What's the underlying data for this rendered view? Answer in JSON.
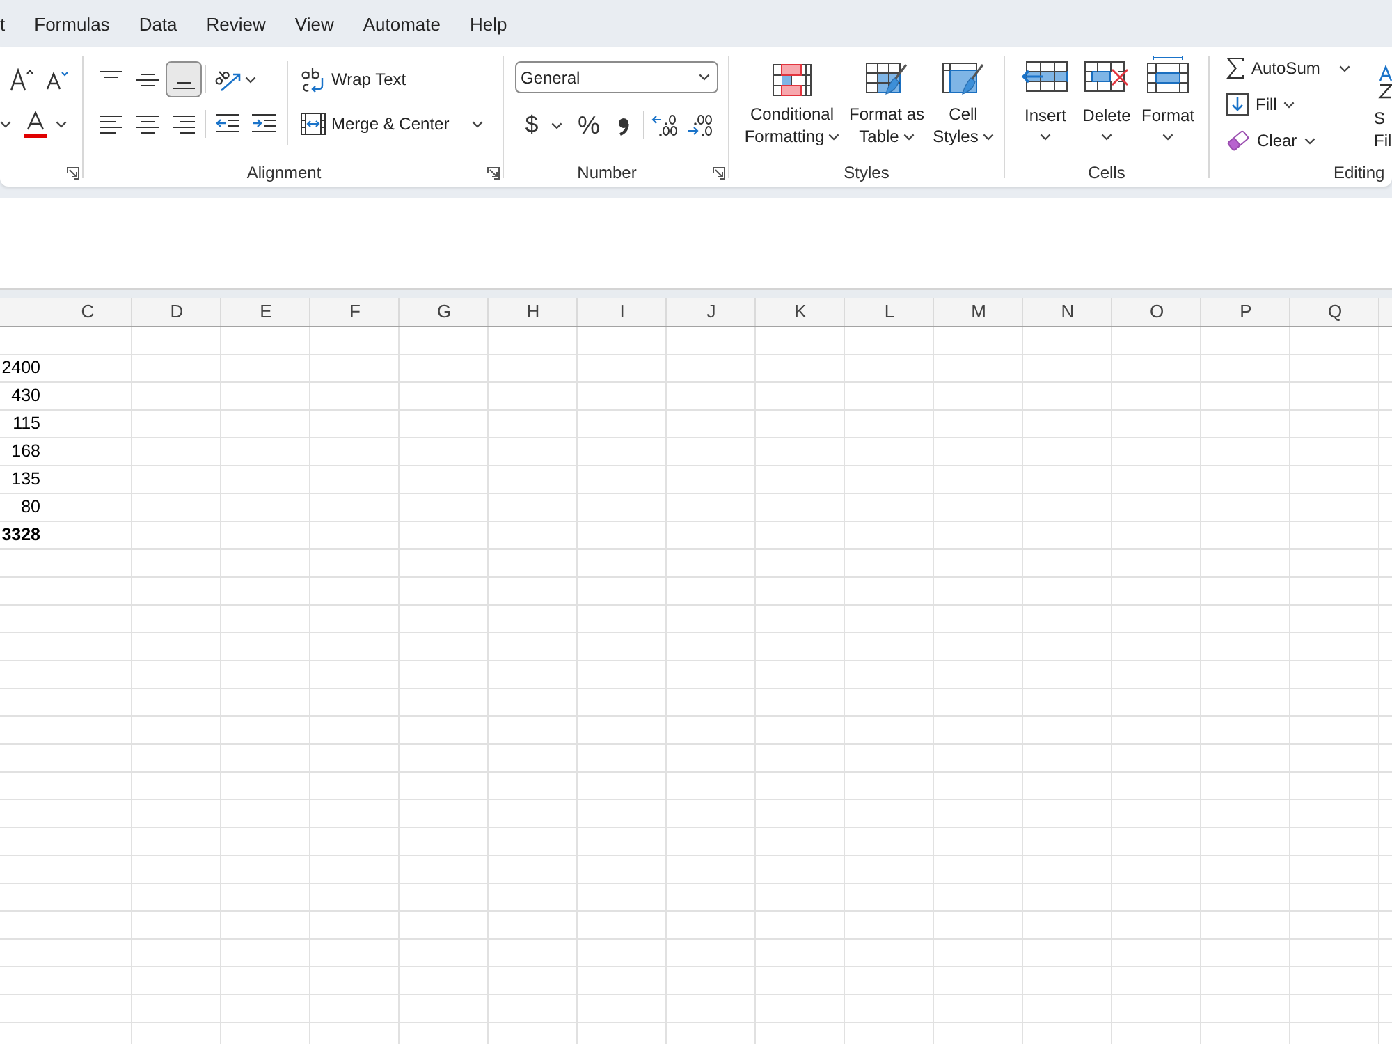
{
  "menu_tabs": [
    {
      "label": "t",
      "selected": false
    },
    {
      "label": "Formulas",
      "selected": false
    },
    {
      "label": "Data",
      "selected": false
    },
    {
      "label": "Review",
      "selected": false
    },
    {
      "label": "View",
      "selected": false
    },
    {
      "label": "Automate",
      "selected": false
    },
    {
      "label": "Help",
      "selected": false
    }
  ],
  "ribbon": {
    "alignment": {
      "label": "Alignment",
      "vertical": [
        {
          "kind": "top",
          "selected": false
        },
        {
          "kind": "middle",
          "selected": false
        },
        {
          "kind": "bottom",
          "selected": true
        }
      ],
      "horizontal": [
        {
          "kind": "left",
          "selected": false
        },
        {
          "kind": "center",
          "selected": false
        },
        {
          "kind": "right",
          "selected": false
        }
      ],
      "wrap_text": "Wrap Text",
      "merge": "Merge & Center"
    },
    "number": {
      "label": "Number",
      "format": "General",
      "currency": "$",
      "percent": "%"
    },
    "styles": {
      "label": "Styles",
      "buttons": [
        {
          "kind": "conditional",
          "lines": [
            "Conditional",
            "Formatting"
          ]
        },
        {
          "kind": "table",
          "lines": [
            "Format as",
            "Table"
          ]
        },
        {
          "kind": "cell",
          "lines": [
            "Cell",
            "Styles"
          ]
        }
      ]
    },
    "cells": {
      "label": "Cells",
      "buttons": [
        {
          "kind": "insert",
          "label": "Insert"
        },
        {
          "kind": "delete",
          "label": "Delete"
        },
        {
          "kind": "format",
          "label": "Format"
        }
      ]
    },
    "editing": {
      "label": "Editing",
      "items": [
        {
          "kind": "autosum",
          "label": "AutoSum"
        },
        {
          "kind": "fill",
          "label": "Fill"
        },
        {
          "kind": "clear",
          "label": "Clear"
        }
      ],
      "sort_filter": {
        "lines": [
          "S",
          "Fil"
        ]
      }
    }
  },
  "sheet": {
    "columns": [
      "C",
      "D",
      "E",
      "F",
      "G",
      "H",
      "I",
      "J",
      "K",
      "L",
      "M",
      "N",
      "O",
      "P",
      "Q"
    ],
    "column_1": [
      {
        "value": "2400",
        "bold": false
      },
      {
        "value": "430",
        "bold": false
      },
      {
        "value": "115",
        "bold": false
      },
      {
        "value": "168",
        "bold": false
      },
      {
        "value": "135",
        "bold": false
      },
      {
        "value": "80",
        "bold": false
      },
      {
        "value": "3328",
        "bold": true
      }
    ]
  }
}
